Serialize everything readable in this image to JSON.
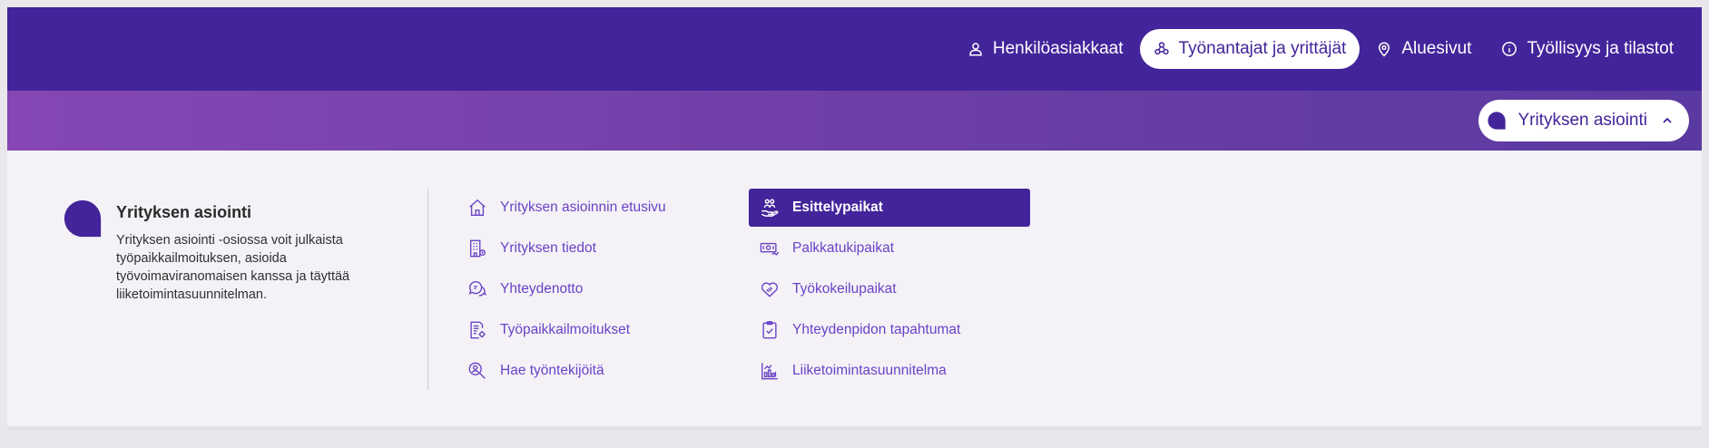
{
  "colors": {
    "primary": "#43249a",
    "band_start": "#8647b4",
    "link": "#6a42c6",
    "panel_bg": "#f4f2f7"
  },
  "topnav": {
    "items": [
      {
        "label": "Henkilöasiakkaat",
        "icon": "person-icon",
        "active": false
      },
      {
        "label": "Työnantajat ja yrittäjät",
        "icon": "network-icon",
        "active": true
      },
      {
        "label": "Aluesivut",
        "icon": "location-pin-icon",
        "active": false
      },
      {
        "label": "Työllisyys ja tilastot",
        "icon": "info-icon",
        "active": false
      }
    ]
  },
  "section": {
    "label": "Yrityksen asiointi",
    "expanded": true
  },
  "intro": {
    "title": "Yrityksen asiointi",
    "text": "Yrityksen asiointi -osiossa voit julkaista työpaikkailmoituksen, asioida työvoimaviranomaisen kanssa ja täyttää liiketoimintasuunnitelman."
  },
  "menu": {
    "col1": [
      {
        "label": "Yrityksen asioinnin etusivu",
        "icon": "home-icon"
      },
      {
        "label": "Yrityksen tiedot",
        "icon": "building-icon"
      },
      {
        "label": "Yhteydenotto",
        "icon": "chat-bubbles-icon"
      },
      {
        "label": "Työpaikkailmoitukset",
        "icon": "document-gear-icon"
      },
      {
        "label": "Hae työntekijöitä",
        "icon": "person-search-icon"
      }
    ],
    "col2": [
      {
        "label": "Esittelypaikat",
        "icon": "hand-people-icon",
        "active": true
      },
      {
        "label": "Palkkatukipaikat",
        "icon": "money-icon"
      },
      {
        "label": "Työkokeilupaikat",
        "icon": "handshake-heart-icon"
      },
      {
        "label": "Yhteydenpidon tapahtumat",
        "icon": "clipboard-check-icon"
      },
      {
        "label": "Liiketoimintasuunnitelma",
        "icon": "bar-chart-icon"
      }
    ]
  }
}
